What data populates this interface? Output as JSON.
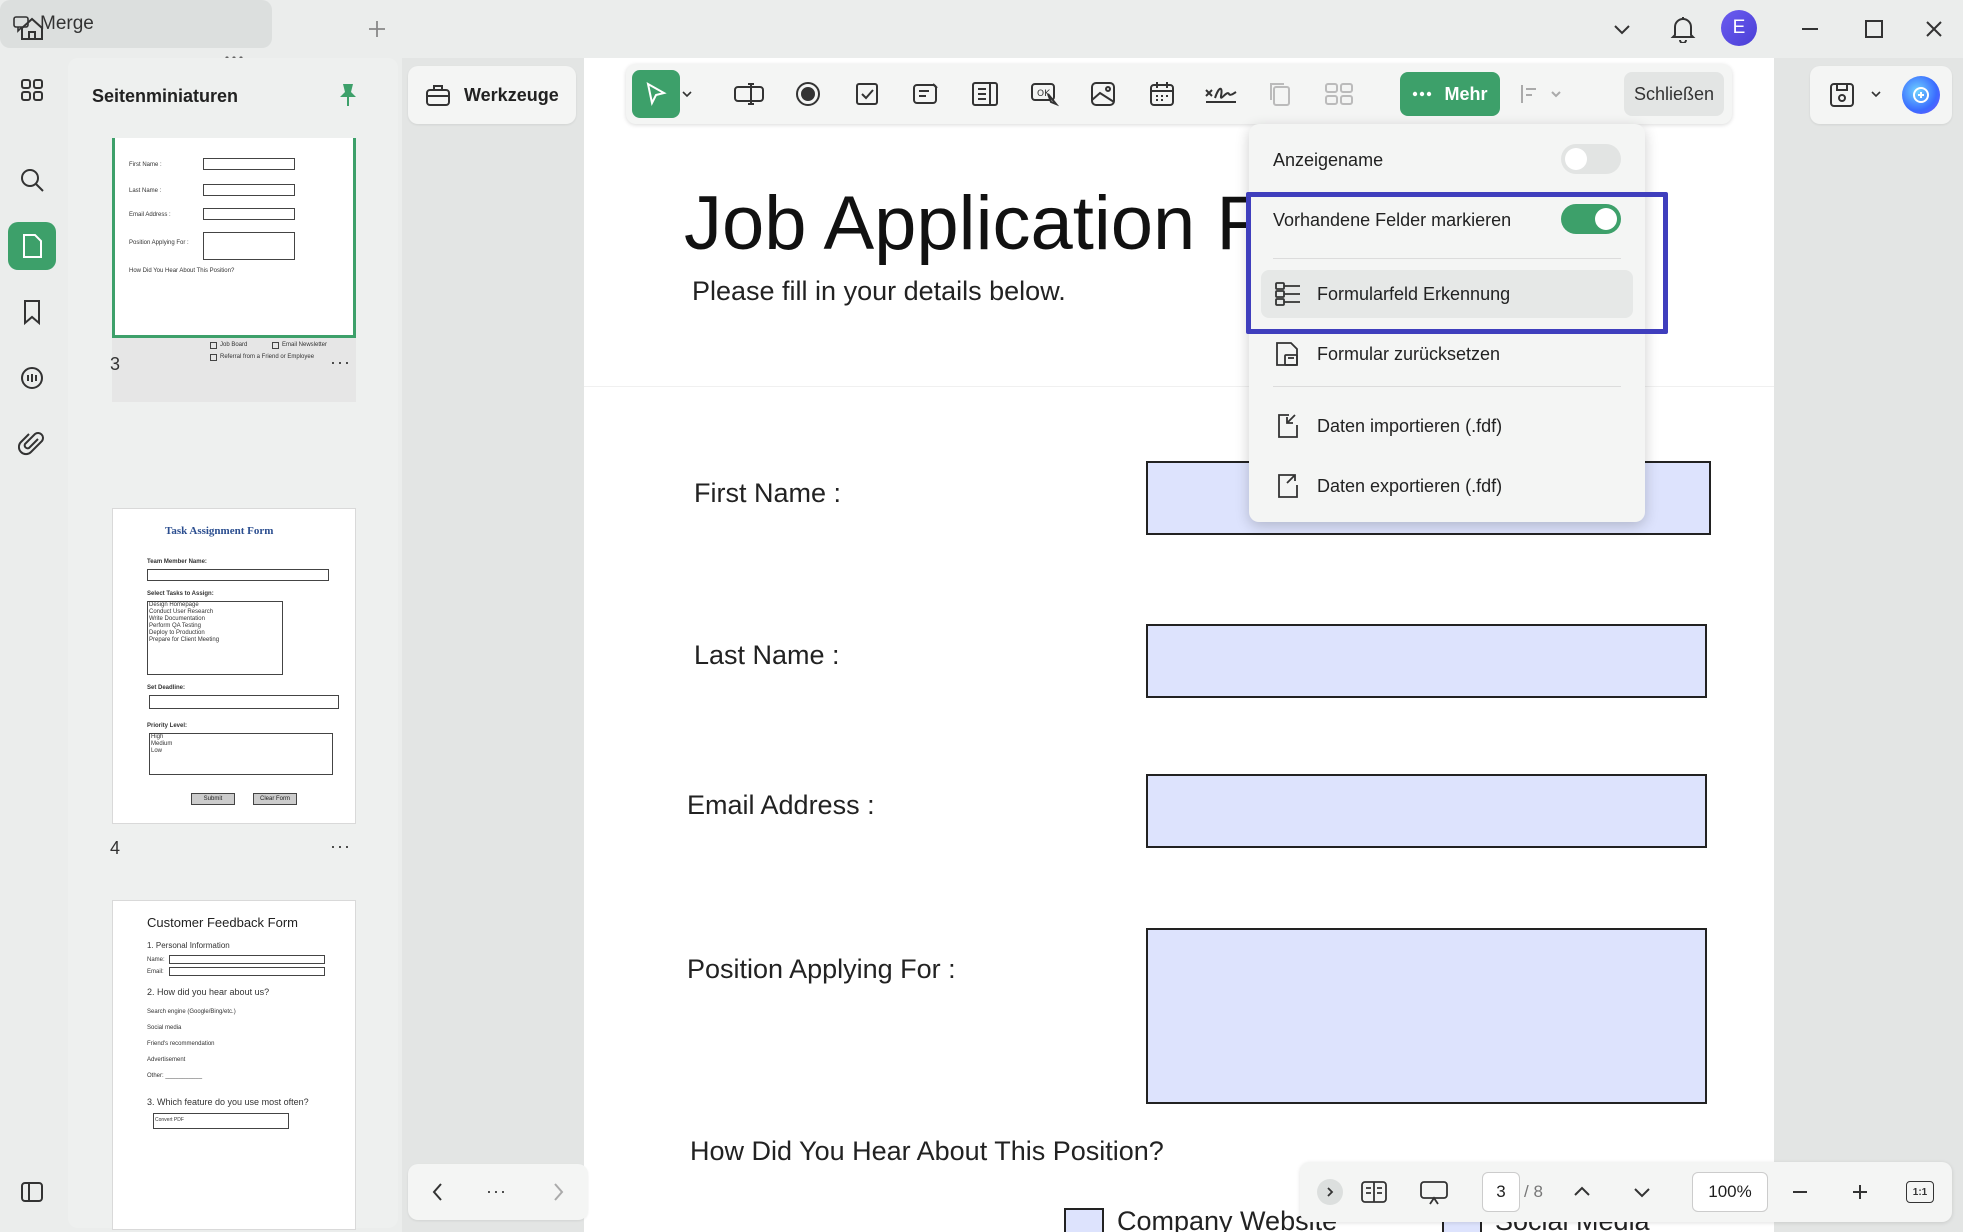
{
  "titlebar": {
    "tab_label": "Merge",
    "avatar_letter": "E"
  },
  "thumbnails": {
    "panel_title": "Seitenminiaturen",
    "pages": [
      {
        "number": "3",
        "more": "···"
      },
      {
        "number": "4",
        "more": "···"
      },
      {
        "number": "",
        "more": ""
      }
    ],
    "p3": {
      "first_name": "First Name :",
      "last_name": "Last Name :",
      "email": "Email Address :",
      "position": "Position Applying For :",
      "how": "How Did You Hear About This Position?",
      "job_board": "Job Board",
      "email_newsletter": "Email Newsletter",
      "referral": "Referral from a Friend or Employee"
    },
    "p4": {
      "title": "Task Assignment Form",
      "team_member": "Team Member Name:",
      "select_tasks": "Select Tasks to Assign:",
      "tasks": [
        "Design Homepage",
        "Conduct User Research",
        "Write Documentation",
        "Perform QA Testing",
        "Deploy to Production",
        "Prepare for Client Meeting"
      ],
      "set_deadline": "Set Deadline:",
      "priority": "Priority Level:",
      "levels": [
        "High",
        "Medium",
        "Low"
      ],
      "submit": "Submit",
      "clear": "Clear Form"
    },
    "p5": {
      "title": "Customer Feedback Form",
      "section1": "1. Personal Information",
      "name": "Name:",
      "email": "Email:",
      "section2": "2. How did you hear about us?",
      "options": [
        "Search engine (Google/Bing/etc.)",
        "Social media",
        "Friend's recommendation",
        "Advertisement",
        "Other: ___________"
      ],
      "section3": "3. Which feature do you use most often?",
      "field": "Convert PDF"
    }
  },
  "toolbar": {
    "werkzeuge": "Werkzeuge",
    "mehr": "Mehr",
    "schliessen": "Schließen"
  },
  "dropdown": {
    "anzeigename": "Anzeigename",
    "anzeigename_on": false,
    "vorhandene": "Vorhandene Felder markieren",
    "vorhandene_on": true,
    "erkennung": "Formularfeld Erkennung",
    "zuruecksetzen": "Formular zurücksetzen",
    "importieren": "Daten importieren (.fdf)",
    "exportieren": "Daten exportieren (.fdf)"
  },
  "document": {
    "title": "Job Application Fo",
    "subtitle": "Please fill in your details below.",
    "first_name": "First Name :",
    "last_name": "Last Name :",
    "email": "Email Address :",
    "position": "Position Applying For :",
    "how": "How Did You Hear About This Position?",
    "option1": "Company Website",
    "option2": "Social Media"
  },
  "navigation": {
    "more": "···"
  },
  "statusbar": {
    "current_page": "3",
    "total_pages": "/ 8",
    "zoom": "100%",
    "fit": "1:1"
  },
  "colors": {
    "accent": "#3da06a",
    "highlight": "#3f3ebd",
    "field_fill": "#dde3fd"
  }
}
